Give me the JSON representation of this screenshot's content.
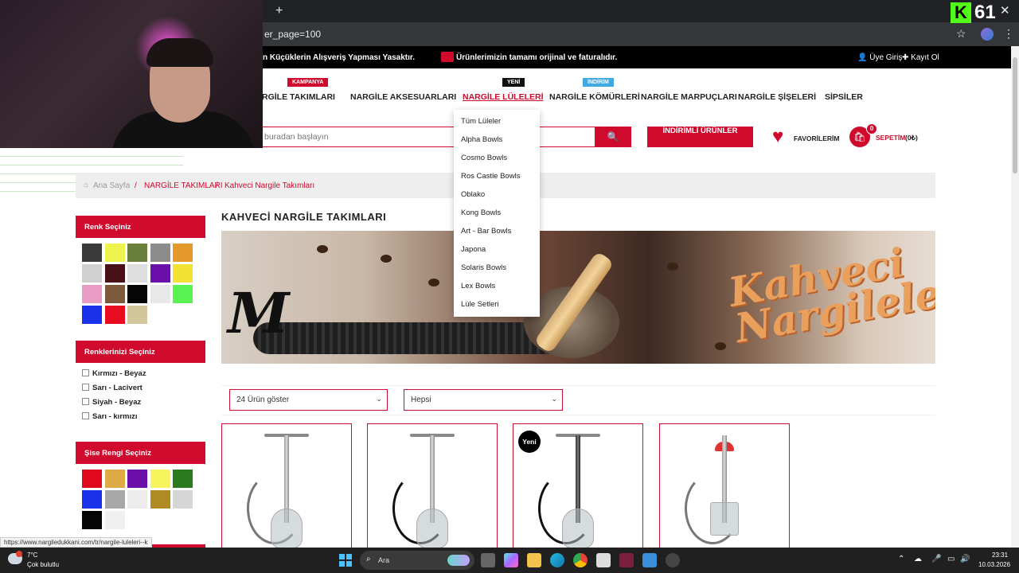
{
  "browser": {
    "url_fragment": "er_page=100",
    "new_tab_symbol": "+",
    "tab_close_symbol": "×",
    "window_close_symbol": "✕"
  },
  "overlay": {
    "platform_letter": "K",
    "viewer_count": "61"
  },
  "promo": {
    "left_text": "n Küçüklerin Alışveriş Yapması Yasaktır.",
    "mid_text": "Ürünlerimizin tamamı orijinal ve faturalıdır.",
    "login": "Üye Giriş",
    "signup": "Kayıt Ol"
  },
  "nav": {
    "items": [
      {
        "label": "RGİLE TAKIMLARI",
        "badge": "KAMPANYA",
        "badge_color": "#cf0a2c"
      },
      {
        "label": "NARGİLE AKSESUARLARI"
      },
      {
        "label": "NARGİLE LÜLELERİ",
        "badge": "YENİ",
        "badge_color": "#111111"
      },
      {
        "label": "NARGİLE KÖMÜRLERİ",
        "badge": "İNDİRİM",
        "badge_color": "#3fa9e0"
      },
      {
        "label": "NARGİLE MARPUÇLARI"
      },
      {
        "label": "NARGİLE ŞİŞELERİ"
      },
      {
        "label": "SİPSİLER"
      }
    ],
    "dropdown": [
      "Tüm Lüleler",
      "Alpha Bowls",
      "Cosmo Bowls",
      "Ros Castle Bowls",
      "Oblako",
      "Kong Bowls",
      "Art - Bar Bowls",
      "Japona",
      "Solaris Bowls",
      "Lex Bowls",
      "Lüle Setleri"
    ]
  },
  "search": {
    "placeholder": "buradan başlayın",
    "button_icon": "search-icon"
  },
  "header_actions": {
    "discount_button": "İNDİRİMLİ ÜRÜNLER",
    "favorites": "FAVORİLERİM",
    "cart_label": "SEPETİM",
    "cart_amount": "(0₺)",
    "cart_count": "0"
  },
  "breadcrumb": {
    "home": "Ana Sayfa",
    "sep": "/",
    "level2": "NARGİLE TAKIMLARI",
    "level3": "Kahveci Nargile Takımları"
  },
  "sidebar": {
    "color_heading": "Renk Seçiniz",
    "colors": [
      "#3a3a3a",
      "#eef24c",
      "#6b7f3c",
      "#8c8c8c",
      "#e39a2a",
      "#d0d0d0",
      "#4a1018",
      "#dedede",
      "#6a0fa8",
      "#f2e233",
      "#e99cc4",
      "#7d5a3c",
      "#050505",
      "#e8e8e8",
      "#59f251",
      "#1a33ea",
      "#e80c1e",
      "#d2c79a"
    ],
    "multi_heading": "Renklerinizi Seçiniz",
    "multi_options": [
      "Kırmızı - Beyaz",
      "Sarı - Lacivert",
      "Siyah - Beyaz",
      "Sarı - kırmızı"
    ],
    "bottle_heading": "Şise Rengi Seçiniz",
    "bottle_colors": [
      "#e0081d",
      "#deaa45",
      "#6a0fa8",
      "#f7f35c",
      "#2c7a1f",
      "#1a33ea",
      "#a8a8a8",
      "#ececec",
      "#b08b24",
      "#d6d6d6",
      "#050505",
      "#f0f0f0"
    ]
  },
  "main": {
    "title": "KAHVECİ NARGİLE TAKIMLARI",
    "banner_logo": "M",
    "banner_script_line1": "Kahveci",
    "banner_script_line2": "Nargileler",
    "per_page_select": "24 Ürün göster",
    "filter_select": "Hepsi",
    "new_badge": "Yeni"
  },
  "status_bar_url": "https://www.nargiledukkani.com/tr/nargile-luleleri--k",
  "taskbar": {
    "temperature": "7°C",
    "weather": "Çok bulutlu",
    "search_label": "Ara",
    "time": "23:31",
    "date": "10.03.2026"
  },
  "colors": {
    "brand_red": "#cf0a2c",
    "promo_bg": "#000000",
    "taskbar_bg": "#202020"
  }
}
